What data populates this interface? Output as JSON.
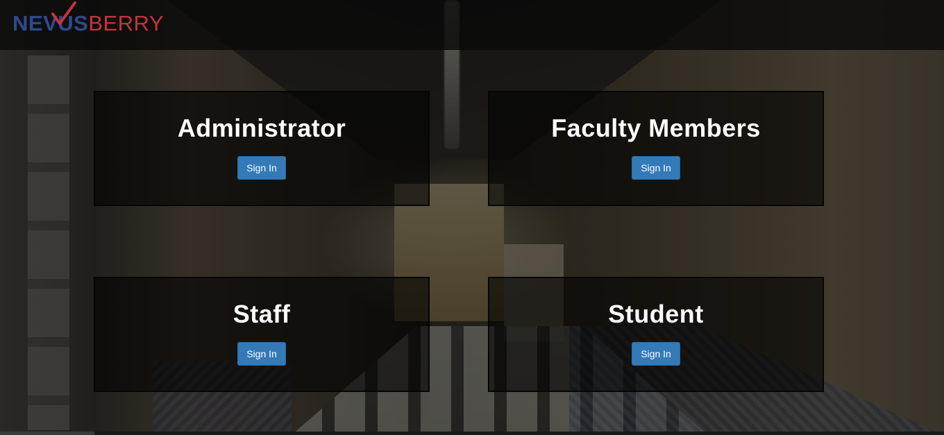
{
  "brand": {
    "logo_primary": "NEVUS",
    "logo_secondary": "BERRY",
    "primary_color": "#2f4a8c",
    "accent_color": "#c8343c"
  },
  "roles": [
    {
      "title": "Administrator",
      "button_label": "Sign In"
    },
    {
      "title": "Faculty Members",
      "button_label": "Sign In"
    },
    {
      "title": "Staff",
      "button_label": "Sign In"
    },
    {
      "title": "Student",
      "button_label": "Sign In"
    }
  ],
  "colors": {
    "button_bg": "#337ab7",
    "card_bg": "rgba(0,0,0,0.58)",
    "header_bg": "rgba(10,10,10,0.82)"
  }
}
